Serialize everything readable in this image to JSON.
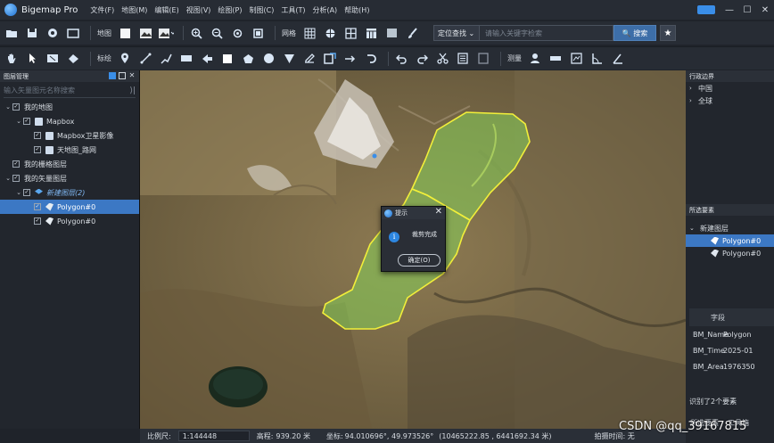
{
  "app": {
    "title": "Bigemap Pro"
  },
  "menu": [
    "文件(F)",
    "地图(M)",
    "编辑(E)",
    "视图(V)",
    "绘图(P)",
    "制图(C)",
    "工具(T)",
    "分析(A)",
    "帮助(H)"
  ],
  "window_controls": {
    "minimize": "—",
    "maximize": "☐",
    "close": "✕"
  },
  "toolbar1": {
    "map_label": "地图",
    "grid_label": "网格",
    "locate_select": "定位查找 ⌄",
    "search_placeholder": "请输入关键字检索",
    "search_button": "🔍 搜索"
  },
  "toolbar2": {
    "mark_label": "标绘",
    "measure_label": "测量"
  },
  "layer_panel": {
    "title": "图层管理",
    "search_placeholder": "输入矢量图元名称搜索",
    "tree": [
      {
        "label": "我的地图",
        "arrow": "⌄",
        "checked": true,
        "indent": 0
      },
      {
        "label": "Mapbox",
        "arrow": "⌄",
        "checked": true,
        "indent": 1
      },
      {
        "label": "Mapbox卫星影像",
        "arrow": "",
        "checked": true,
        "indent": 2
      },
      {
        "label": "天地图_路网",
        "arrow": "",
        "checked": true,
        "indent": 2
      },
      {
        "label": "我的栅格图层",
        "arrow": "",
        "checked": true,
        "indent": 0
      },
      {
        "label": "我的矢量图层",
        "arrow": "⌄",
        "checked": true,
        "indent": 0
      },
      {
        "label": "新建图层(2)",
        "arrow": "⌄",
        "checked": true,
        "indent": 1
      },
      {
        "label": "Polygon#0",
        "arrow": "",
        "checked": true,
        "indent": 2,
        "selected": true
      },
      {
        "label": "Polygon#0",
        "arrow": "",
        "checked": true,
        "indent": 2
      }
    ]
  },
  "admin_panel": {
    "title": "行政边界",
    "items": [
      "中国",
      "全球"
    ]
  },
  "selected_panel": {
    "title": "所选要素",
    "layer": "新建图层",
    "items": [
      "Polygon#0",
      "Polygon#0"
    ]
  },
  "field_table": {
    "header": "字段",
    "rows": [
      {
        "key": "BM_Name",
        "value": "Polygon"
      },
      {
        "key": "BM_Time",
        "value": "2025-01"
      },
      {
        "key": "BM_Area",
        "value": "1976350"
      }
    ]
  },
  "selection_count": "识别了2个要素",
  "right_tabs": [
    "所选要素",
    "工具箱"
  ],
  "statusbar": {
    "scale_label": "比例尺:",
    "scale_value": "1:144448",
    "elev_label": "高程:",
    "elev_value": "939.20 米",
    "coord_label": "坐标:",
    "coord_value": "94.010696°, 49.973526°",
    "proj_value": "(10465222.85 , 6441692.34 米)",
    "shot_label": "拍摄时间: 无"
  },
  "dialog": {
    "title": "提示",
    "message": "裁剪完成",
    "ok": "确定(O)"
  },
  "watermark": "CSDN @qq_39167815",
  "colors": {
    "accent": "#3c78c4",
    "polygon_edge": "#f2ef3a",
    "polygon_fill": "#7fd25a"
  }
}
